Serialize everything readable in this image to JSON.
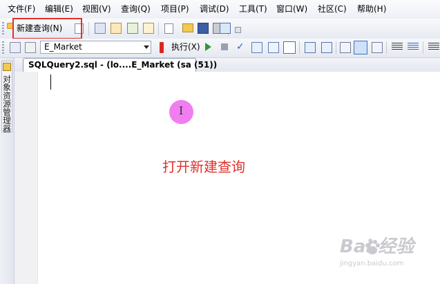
{
  "menubar": {
    "items": [
      "文件(F)",
      "编辑(E)",
      "视图(V)",
      "查询(Q)",
      "项目(P)",
      "调试(D)",
      "工具(T)",
      "窗口(W)",
      "社区(C)",
      "帮助(H)"
    ]
  },
  "toolbar": {
    "new_query_label": "新建查询(N)",
    "database_selected": "E_Market",
    "execute_label": "执行(X)"
  },
  "side_panel": {
    "object_explorer_label": "对象资源管理器"
  },
  "document_tab": {
    "label": "SQLQuery2.sql - (lo....E_Market (sa (51))"
  },
  "annotation": {
    "text": "打开新建查询"
  },
  "watermark": {
    "main": "Bai 经验",
    "sub": "jingyan.baidu.com"
  },
  "colors": {
    "highlight": "#e0302a",
    "cursor_marker": "#f07ef0"
  }
}
